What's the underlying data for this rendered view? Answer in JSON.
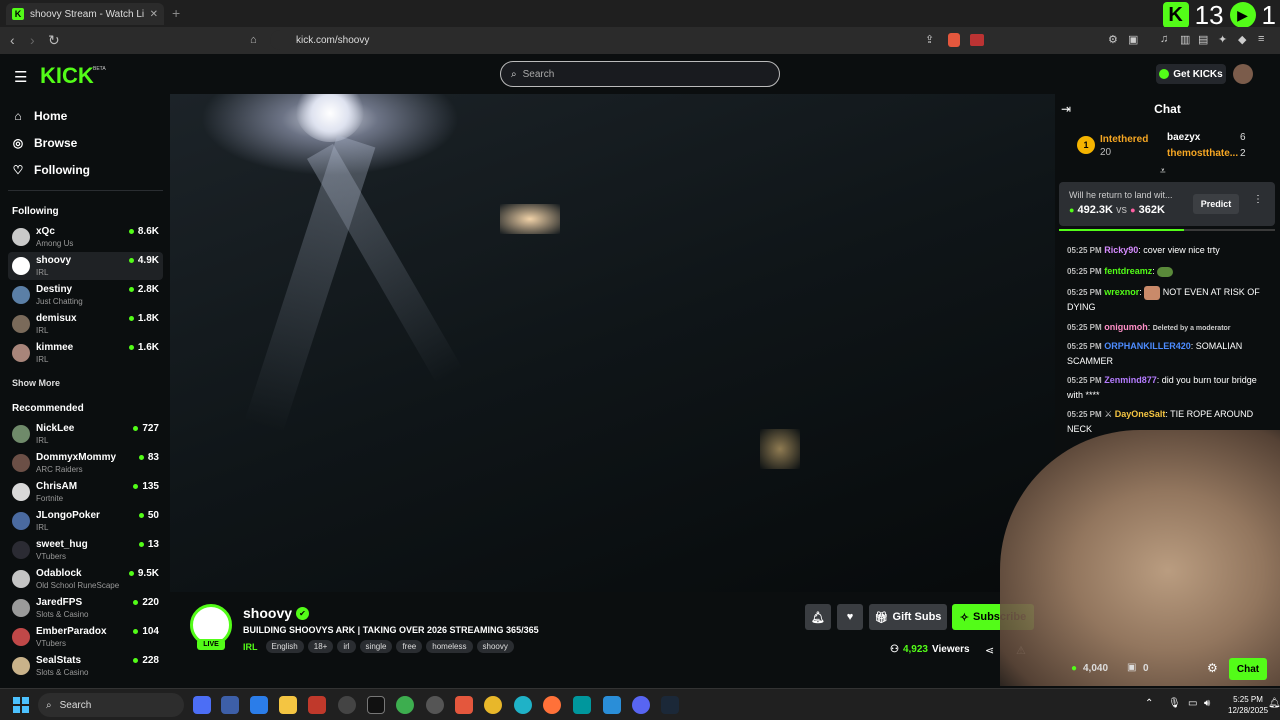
{
  "browser": {
    "tab_title": "shoovy Stream - Watch Live o",
    "new_tab": "+",
    "url": "kick.com/shoovy",
    "overlay_left": "13",
    "overlay_right": "1"
  },
  "header": {
    "logo": "KICK",
    "beta": "BETA",
    "search_placeholder": "Search",
    "get_kicks": "Get KICKs"
  },
  "sidebar": {
    "nav": [
      {
        "label": "Home",
        "icon": "home-icon"
      },
      {
        "label": "Browse",
        "icon": "compass-icon"
      },
      {
        "label": "Following",
        "icon": "heart-icon"
      }
    ],
    "following_heading": "Following",
    "following": [
      {
        "name": "xQc",
        "category": "Among Us",
        "viewers": "8.6K",
        "color": "#c9c9c9"
      },
      {
        "name": "shoovy",
        "category": "IRL",
        "viewers": "4.9K",
        "color": "#ffffff"
      },
      {
        "name": "Destiny",
        "category": "Just Chatting",
        "viewers": "2.8K",
        "color": "#5b7fa6"
      },
      {
        "name": "demisux",
        "category": "IRL",
        "viewers": "1.8K",
        "color": "#7a6a5a"
      },
      {
        "name": "kimmee",
        "category": "IRL",
        "viewers": "1.6K",
        "color": "#a8857a"
      }
    ],
    "show_more": "Show More",
    "recommended_heading": "Recommended",
    "recommended": [
      {
        "name": "NickLee",
        "category": "IRL",
        "viewers": "727",
        "color": "#6f8a6a"
      },
      {
        "name": "DommyxMommy",
        "category": "ARC Raiders",
        "viewers": "83",
        "color": "#6b4f46"
      },
      {
        "name": "ChrisAM",
        "category": "Fortnite",
        "viewers": "135",
        "color": "#d8d8d8"
      },
      {
        "name": "JLongoPoker",
        "category": "IRL",
        "viewers": "50",
        "color": "#4a6aa0"
      },
      {
        "name": "sweet_hug",
        "category": "VTubers",
        "viewers": "13",
        "color": "#2b2b33"
      },
      {
        "name": "Odablock",
        "category": "Old School RuneScape",
        "viewers": "9.5K",
        "color": "#c4c4c4"
      },
      {
        "name": "JaredFPS",
        "category": "Slots & Casino",
        "viewers": "220",
        "color": "#9a9a9a"
      },
      {
        "name": "EmberParadox",
        "category": "VTubers",
        "viewers": "104",
        "color": "#c04848"
      },
      {
        "name": "SealStats",
        "category": "Slots & Casino",
        "viewers": "228",
        "color": "#c9b28a"
      }
    ]
  },
  "stream": {
    "live_badge": "LIVE",
    "channel": "shoovy",
    "verified_icon": "✔",
    "title": "BUILDING SHOOVYS ARK | TAKING OVER 2026 STREAMING 365/365",
    "category": "IRL",
    "tags": [
      "English",
      "18+",
      "irl",
      "single",
      "free",
      "homeless",
      "shoovy"
    ],
    "gift_subs": "Gift Subs",
    "subscribe": "Subscribe",
    "viewers": "4,923",
    "viewers_label": "Viewers"
  },
  "chat": {
    "title": "Chat",
    "leaderboard": {
      "rank": "1",
      "top_user": "Intethered",
      "top_count": "20",
      "users": [
        {
          "name": "baezyx",
          "count": "6"
        },
        {
          "name": "themostthate...",
          "count": "2"
        }
      ]
    },
    "prediction": {
      "question": "Will he return to land wit...",
      "value_a": "492.3K",
      "vs": "vs",
      "value_b": "362K",
      "button": "Predict",
      "progress": 0.58
    },
    "messages": [
      {
        "time": "05:25 PM",
        "user": "Ricky90",
        "user_color": "#d68cff",
        "text": "cover view nice trty"
      },
      {
        "time": "05:25 PM",
        "user": "fentdreamz",
        "user_color": "#53fc18",
        "text": ""
      },
      {
        "time": "05:25 PM",
        "user": "wrexnor",
        "user_color": "#53fc18",
        "text": "NOT EVEN AT RISK OF DYING"
      },
      {
        "time": "05:25 PM",
        "user": "onigumoh",
        "user_color": "#ff8fc7",
        "text": "Deleted by a moderator"
      },
      {
        "time": "05:25 PM",
        "user": "ORPHANKILLER420",
        "user_color": "#4d8cff",
        "text": "SOMALIAN SCAMMER"
      },
      {
        "time": "05:25 PM",
        "user": "Zenmind877",
        "user_color": "#b57cff",
        "text": "did you burn tour bridge with ****"
      },
      {
        "time": "05:25 PM",
        "user": "DayOneSalt",
        "user_color": "#f5c542",
        "text": "TIE ROPE AROUND NECK"
      }
    ],
    "footer_count_a": "4,040",
    "footer_count_b": "0",
    "chat_button": "Chat"
  },
  "taskbar": {
    "search": "Search",
    "time": "5:25 PM",
    "date": "12/28/2025"
  }
}
